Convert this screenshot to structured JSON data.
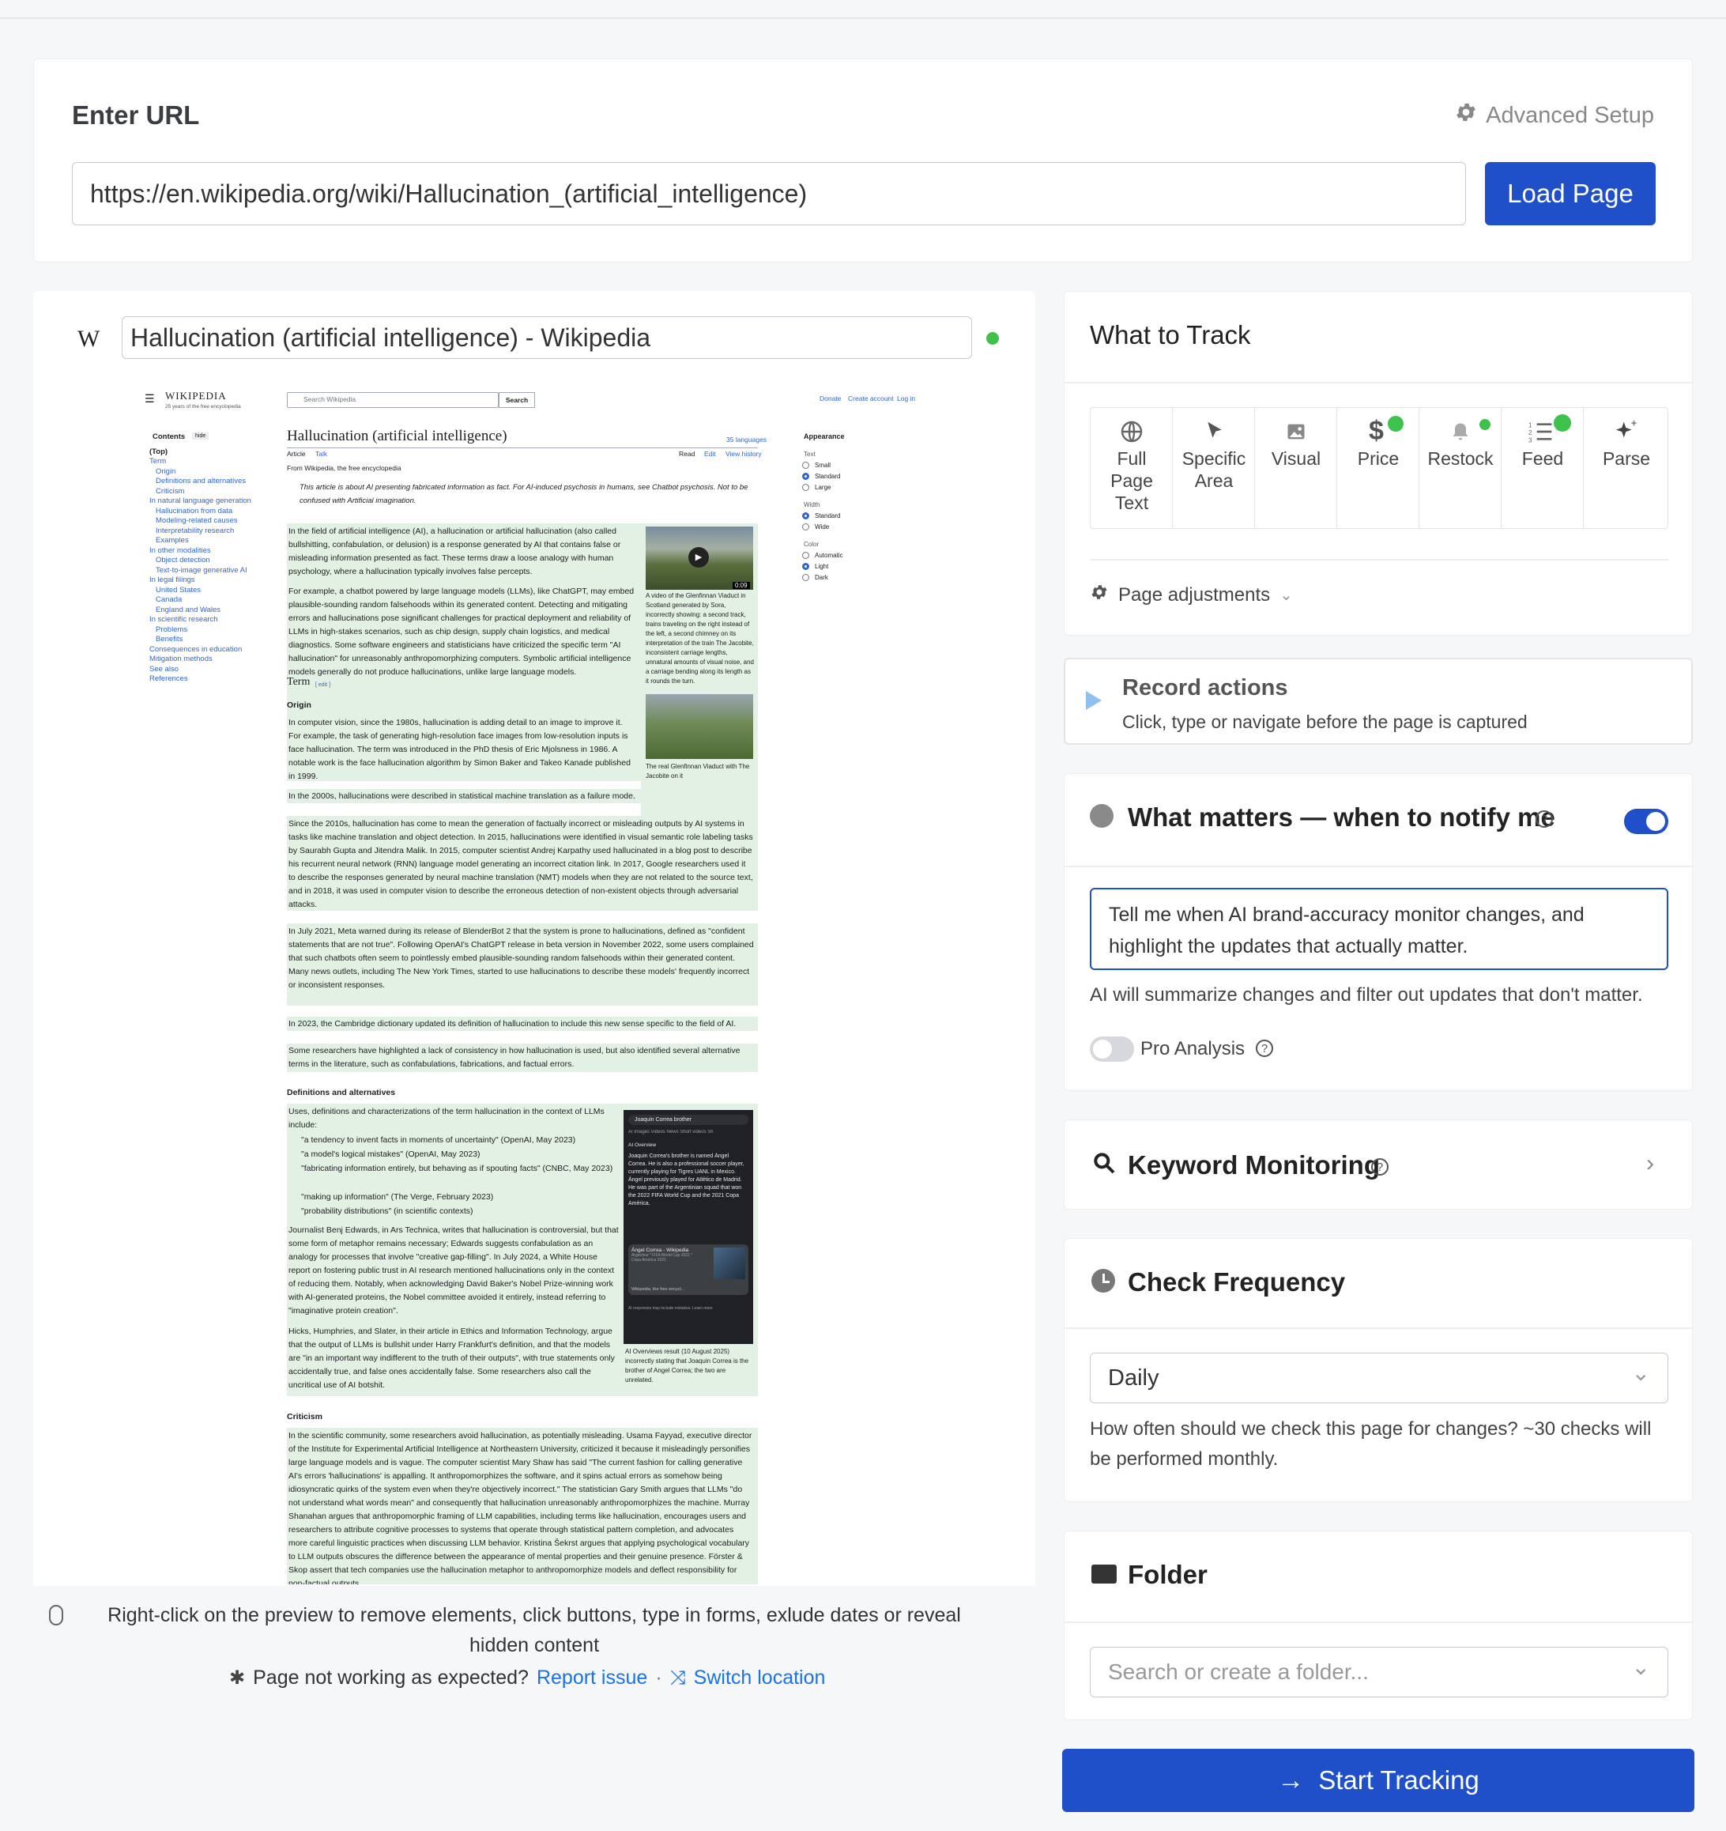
{
  "url_section": {
    "heading": "Enter URL",
    "advanced_setup": "Advanced Setup",
    "url_value": "https://en.wikipedia.org/wiki/Hallucination_(artificial_intelligence)",
    "load_button": "Load Page"
  },
  "preview": {
    "favicon": "W",
    "page_title": "Hallucination (artificial intelligence) - Wikipedia",
    "hint": "Right-click on the preview to remove elements, click buttons, type in forms, exlude dates or reveal hidden content",
    "not_working": "Page not working as expected?",
    "report_issue": "Report issue",
    "separator": "·",
    "switch_location": "Switch location",
    "wiki": {
      "logo": "WIKIPEDIA",
      "logo_sub": "25 years of the free encyclopedia",
      "search_placeholder": "Search Wikipedia",
      "search_btn": "Search",
      "donate": "Donate",
      "create_account": "Create account",
      "login": "Log in",
      "contents": "Contents",
      "hide": "hide",
      "article_title": "Hallucination (artificial intelligence)",
      "languages": "35 languages",
      "tab_article": "Article",
      "tab_talk": "Talk",
      "tab_read": "Read",
      "tab_edit": "Edit",
      "tab_history": "View history",
      "from": "From Wikipedia, the free encyclopedia",
      "hatnote": "This article is about AI presenting fabricated information as fact. For AI-induced psychosis in humans, see Chatbot psychosis. Not to be confused with Artificial imagination.",
      "toc": [
        "(Top)",
        "Term",
        "Origin",
        "Definitions and alternatives",
        "Criticism",
        "In natural language generation",
        "Hallucination from data",
        "Modeling-related causes",
        "Interpretability research",
        "Examples",
        "In other modalities",
        "Object detection",
        "Text-to-image generative AI",
        "In legal filings",
        "United States",
        "Canada",
        "England and Wales",
        "In scientific research",
        "Problems",
        "Benefits",
        "Consequences in education",
        "Mitigation methods",
        "See also",
        "References"
      ],
      "appearance": "Appearance",
      "text_label": "Text",
      "text_opts": [
        "Small",
        "Standard",
        "Large"
      ],
      "width_label": "Width",
      "width_opts": [
        "Standard",
        "Wide"
      ],
      "color_label": "Color",
      "color_opts": [
        "Automatic",
        "Light",
        "Dark"
      ],
      "p1": "In the field of artificial intelligence (AI), a hallucination or artificial hallucination (also called bullshitting, confabulation, or delusion) is a response generated by AI that contains false or misleading information presented as fact. These terms draw a loose analogy with human psychology, where a hallucination typically involves false percepts.",
      "p2": "For example, a chatbot powered by large language models (LLMs), like ChatGPT, may embed plausible-sounding random falsehoods within its generated content. Detecting and mitigating errors and hallucinations pose significant challenges for practical deployment and reliability of LLMs in high-stakes scenarios, such as chip design, supply chain logistics, and medical diagnostics. Some software engineers and statisticians have criticized the specific term \"AI hallucination\" for unreasonably anthropomorphizing computers. Symbolic artificial intelligence models generally do not produce hallucinations, unlike large language models.",
      "video_time": "0:09",
      "cap1": "A video of the Glenfinnan Viaduct in Scotland generated by Sora, incorrectly showing: a second track, trains traveling on the right instead of the left, a second chimney on its interpretation of the train The Jacobite, inconsistent carriage lengths, unnatural amounts of visual noise, and a carriage bending along its length as it rounds the turn.",
      "cap2": "The real Glenfinnan Viaduct with The Jacobite on it",
      "term": "Term",
      "edit": "[ edit ]",
      "origin": "Origin",
      "p3": "In computer vision, since the 1980s, hallucination is adding detail to an image to improve it. For example, the task of generating high-resolution face images from low-resolution inputs is face hallucination. The term was introduced in the PhD thesis of Eric Mjolsness in 1986. A notable work is the face hallucination algorithm by Simon Baker and Takeo Kanade published in 1999.",
      "p4": "In the 2000s, hallucinations were described in statistical machine translation as a failure mode.",
      "p5": "Since the 2010s, hallucination has come to mean the generation of factually incorrect or misleading outputs by AI systems in tasks like machine translation and object detection. In 2015, hallucinations were identified in visual semantic role labeling tasks by Saurabh Gupta and Jitendra Malik. In 2015, computer scientist Andrej Karpathy used hallucinated in a blog post to describe his recurrent neural network (RNN) language model generating an incorrect citation link. In 2017, Google researchers used it to describe the responses generated by neural machine translation (NMT) models when they are not related to the source text, and in 2018, it was used in computer vision to describe the erroneous detection of non-existent objects through adversarial attacks.",
      "p6": "In July 2021, Meta warned during its release of BlenderBot 2 that the system is prone to hallucinations, defined as \"confident statements that are not true\". Following OpenAI's ChatGPT release in beta version in November 2022, some users complained that such chatbots often seem to pointlessly embed plausible-sounding random falsehoods within their generated content. Many news outlets, including The New York Times, started to use hallucinations to describe these models' frequently incorrect or inconsistent responses.",
      "p7": "In 2023, the Cambridge dictionary updated its definition of hallucination to include this new sense specific to the field of AI.",
      "p8": "Some researchers have highlighted a lack of consistency in how hallucination is used, but also identified several alternative terms in the literature, such as confabulations, fabrications, and factual errors.",
      "defs": "Definitions and alternatives",
      "p9": "Uses, definitions and characterizations of the term hallucination in the context of LLMs include:",
      "bullets": [
        "\"a tendency to invent facts in moments of uncertainty\" (OpenAI, May 2023)",
        "\"a model's logical mistakes\" (OpenAI, May 2023)",
        "\"fabricating information entirely, but behaving as if spouting facts\" (CNBC, May 2023)",
        "\"making up information\" (The Verge, February 2023)",
        "\"probability distributions\" (in scientific contexts)"
      ],
      "p10": "Journalist Benj Edwards, in Ars Technica, writes that hallucination is controversial, but that some form of metaphor remains necessary; Edwards suggests confabulation as an analogy for processes that involve \"creative gap-filling\". In July 2024, a White House report on fostering public trust in AI research mentioned hallucinations only in the context of reducing them. Notably, when acknowledging David Baker's Nobel Prize-winning work with AI-generated proteins, the Nobel committee avoided it entirely, instead referring to \"imaginative protein creation\".",
      "p11": "Hicks, Humphries, and Slater, in their article in Ethics and Information Technology, argue that the output of LLMs is bullshit under Harry Frankfurt's definition, and that the models are \"in an important way indifferent to the truth of their outputs\", with true statements only accidentally true, and false ones accidentally false. Some researchers also call the uncritical use of AI botshit.",
      "g_search": "Joaquin Correa brother",
      "g_tabs": "AI   Images   Videos   News   Short videos   Sh",
      "g_overview": "AI Overview",
      "g_text": "Joaquin Correa's brother is named Ángel Correa. He is also a professional soccer player, currently playing for Tigres UANL in Mexico. Ángel previously played for Atlético de Madrid. He was part of the Argentinian squad that won the 2022 FIFA World Cup and the 2021 Copa América.",
      "g_card": "Ángel Correa - Wikipedia",
      "g_card_sub": "Argentina * FIFA World Cup 2022 * Copa América 2021",
      "g_src": "Wikipedia, the free encycl...",
      "g_foot": "AI responses may include mistakes. Learn more",
      "cap3": "AI Overviews result (10 August 2025) incorrectly stating that Joaquin Correa is the brother of Angel Correa; the two are unrelated.",
      "criticism": "Criticism",
      "p12": "In the scientific community, some researchers avoid hallucination, as potentially misleading. Usama Fayyad, executive director of the Institute for Experimental Artificial Intelligence at Northeastern University, criticized it because it misleadingly personifies large language models and is vague. The computer scientist Mary Shaw has said \"The current fashion for calling generative AI's errors 'hallucinations' is appalling. It anthropomorphizes the software, and it spins actual errors as somehow being idiosyncratic quirks of the system even when they're objectively incorrect.\" The statistician Gary Smith argues that LLMs \"do not understand what words mean\" and consequently that hallucination unreasonably anthropomorphizes the machine. Murray Shanahan argues that anthropomorphic framing of LLM capabilities, including terms like hallucination, encourages users and researchers to attribute cognitive processes to systems that operate through statistical pattern completion, and advocates more careful linguistic practices when discussing LLM behavior. Kristina Šekrst argues that applying psychological vocabulary to LLM outputs obscures the difference between the appearance of mental properties and their genuine presence. Förster & Skop assert that tech companies use the hallucination metaphor to anthropomorphize models and deflect responsibility for non-factual outputs."
    }
  },
  "track": {
    "heading": "What to Track",
    "options": [
      {
        "label": "Full\nPage\nText",
        "icon": "globe-icon",
        "dot": false
      },
      {
        "label": "Specific\nArea",
        "icon": "cursor-icon",
        "dot": false
      },
      {
        "label": "Visual",
        "icon": "image-icon",
        "dot": false
      },
      {
        "label": "Price",
        "icon": "dollar-icon",
        "dot": true
      },
      {
        "label": "Restock",
        "icon": "bell-icon",
        "dot": true
      },
      {
        "label": "Feed",
        "icon": "list-icon",
        "dot": true
      },
      {
        "label": "Parse",
        "icon": "sparkle-icon",
        "dot": false
      }
    ],
    "adjustments": "Page adjustments"
  },
  "record": {
    "title": "Record actions",
    "desc": "Click, type or navigate before the page is captured"
  },
  "notify": {
    "title": "What matters — when to notify me",
    "toggle_on": true,
    "prompt": "Tell me when AI brand-accuracy monitor changes, and highlight the updates that actually matter.",
    "note": "AI will summarize changes and filter out updates that don't matter.",
    "pro_label": "Pro Analysis",
    "pro_on": false
  },
  "keyword": {
    "title": "Keyword Monitoring"
  },
  "frequency": {
    "title": "Check Frequency",
    "value": "Daily",
    "desc": "How often should we check this page for changes? ~30 checks will be performed monthly."
  },
  "folder": {
    "title": "Folder",
    "placeholder": "Search or create a folder..."
  },
  "start_button": "Start Tracking",
  "colors": {
    "accent": "#1f4fc9",
    "green": "#3fc24c",
    "link": "#1a73e8"
  }
}
